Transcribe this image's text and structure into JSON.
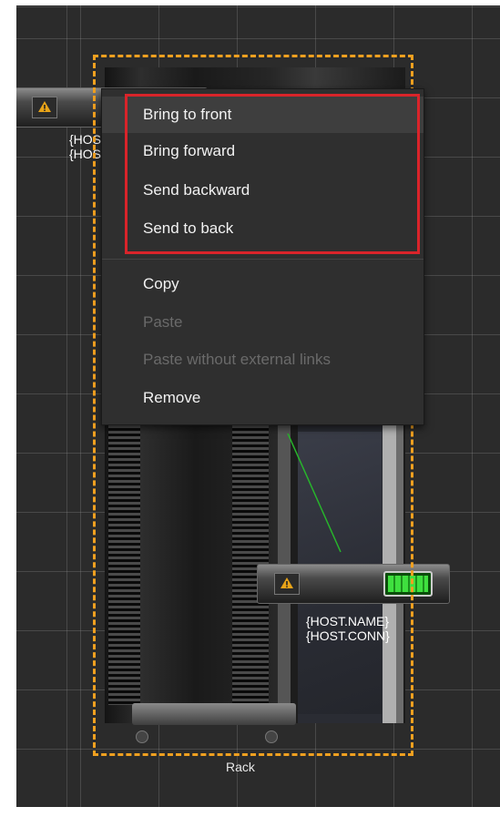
{
  "canvas": {
    "rack_label": "Rack",
    "selection_color": "#f0a020",
    "highlight_color": "#d9242a"
  },
  "device_top": {
    "icon": "warning-icon",
    "label_line1": "{HOS",
    "label_line2": "{HOS"
  },
  "device_bottom": {
    "icon": "warning-icon",
    "status_icon": "battery-icon",
    "label_line1": "{HOST.NAME}",
    "label_line2": "{HOST.CONN}"
  },
  "context_menu": {
    "items": [
      {
        "label": "Bring to front",
        "state": "hover"
      },
      {
        "label": "Bring forward",
        "state": "enabled"
      },
      {
        "label": "Send backward",
        "state": "enabled"
      },
      {
        "label": "Send to back",
        "state": "enabled"
      },
      {
        "label": "Copy",
        "state": "enabled"
      },
      {
        "label": "Paste",
        "state": "disabled"
      },
      {
        "label": "Paste without external links",
        "state": "disabled"
      },
      {
        "label": "Remove",
        "state": "enabled"
      }
    ]
  }
}
